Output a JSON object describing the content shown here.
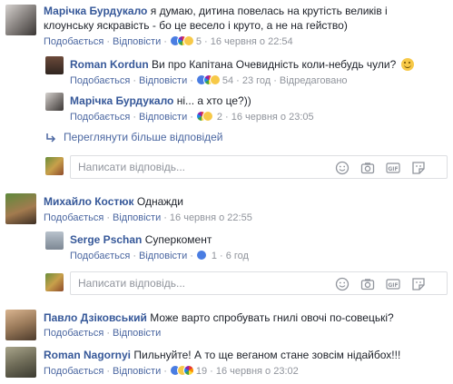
{
  "comments": {
    "c1": {
      "author": "Марічка Бурдукало",
      "text_line1": "я думаю, дитина повелась на крутість великів і",
      "text_line2": "клоунську яскравість - бо це весело і круто, а не на гейство)",
      "like": "Подобається",
      "reply": "Відповісти",
      "count": "5",
      "time": "16 червня о 22:54"
    },
    "r1": {
      "author": "Roman Kordun",
      "text": "Ви про Капітана Очевидність коли-небудь чули?",
      "like": "Подобається",
      "reply": "Відповісти",
      "count": "54",
      "time": "23 год",
      "edited": "Відредаговано"
    },
    "r2": {
      "author": "Марічка Бурдукало",
      "text": "ні... а хто це?))",
      "like": "Подобається",
      "reply": "Відповісти",
      "count": "2",
      "time": "16 червня о 23:05"
    },
    "more_replies": "Переглянути більше відповідей",
    "reply_placeholder": "Написати відповідь...",
    "c2": {
      "author": "Михайло Костюк",
      "text": "Однажди",
      "like": "Подобається",
      "reply": "Відповісти",
      "time": "16 червня о 22:55"
    },
    "r3": {
      "author": "Serge Pschan",
      "text": "Суперкомент",
      "like": "Подобається",
      "reply": "Відповісти",
      "count": "1",
      "time": "6 год"
    },
    "c3": {
      "author": "Павло Дзіковський",
      "text": "Може варто спробувать гнилі овочі по-совецькі?",
      "like": "Подобається",
      "reply": "Відповісти"
    },
    "c4": {
      "author": "Roman Nagornyi",
      "text": "Пильнуйте! А то ще веганом стане зовсім нідайбох!!!",
      "like": "Подобається",
      "reply": "Відповісти",
      "count": "19",
      "time": "16 червня о 23:02"
    }
  },
  "colors": {
    "link": "#365899",
    "meta": "#90949c",
    "border": "#dddfe2"
  }
}
